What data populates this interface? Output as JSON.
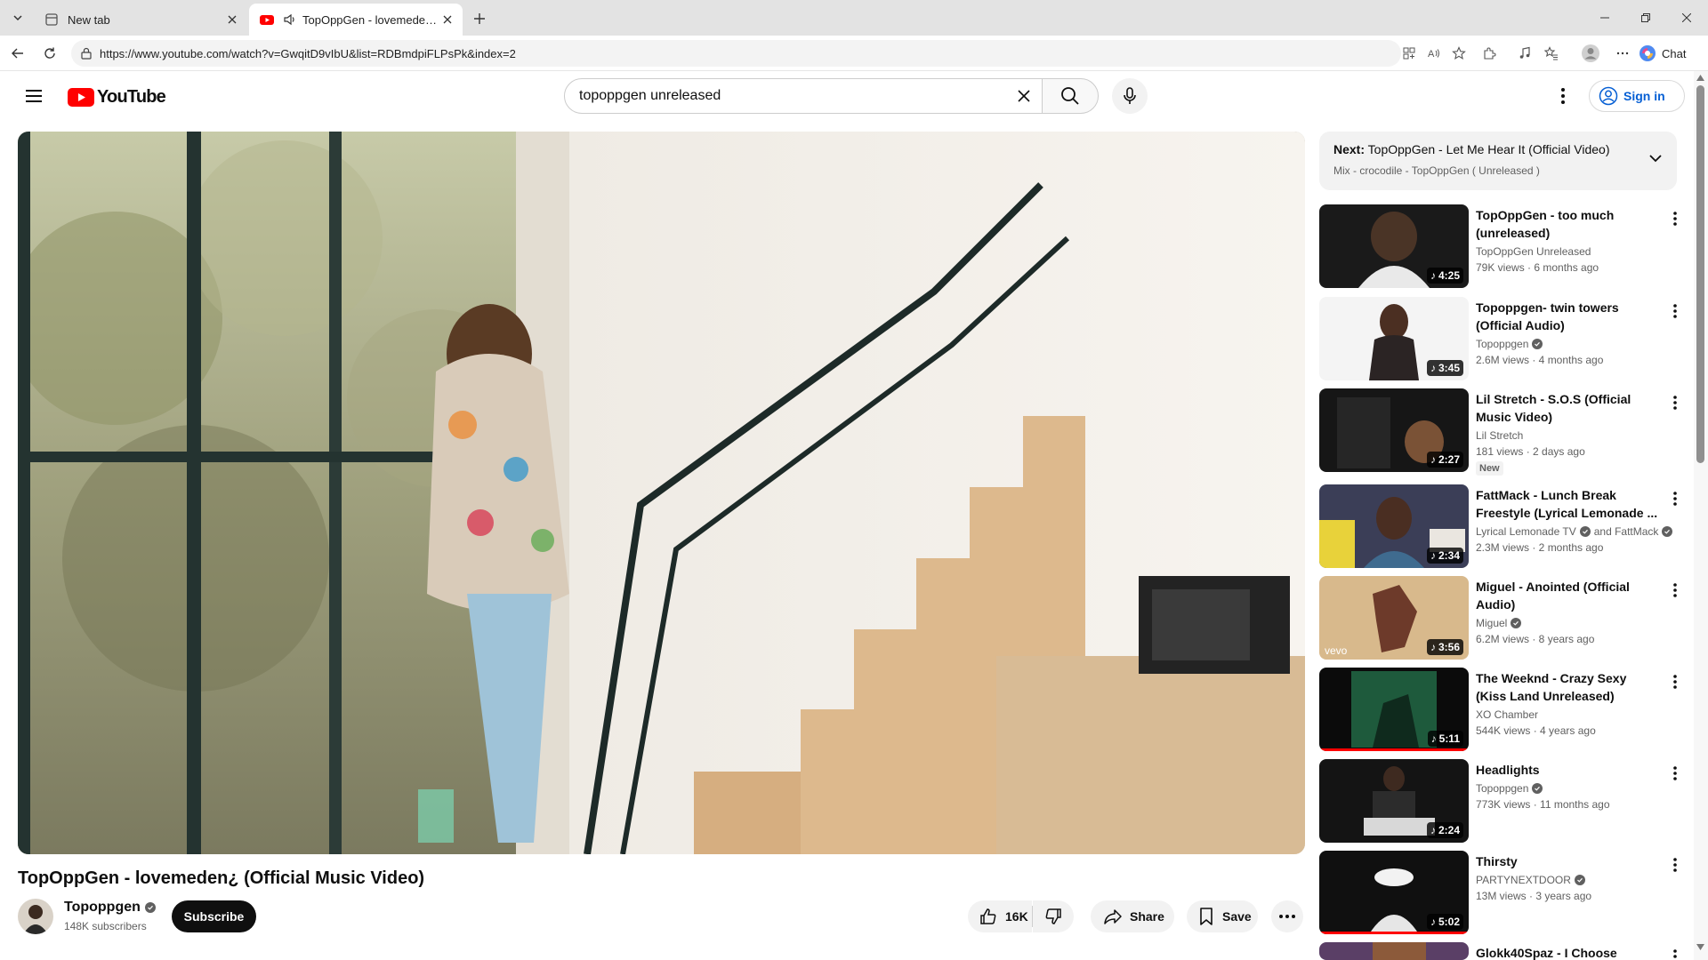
{
  "browser": {
    "tabs": [
      {
        "title": "New tab",
        "active": false
      },
      {
        "title": "TopOppGen - lovemeden¿ (Official Music Video)",
        "active": true
      }
    ],
    "url": "https://www.youtube.com/watch?v=GwqitD9vIbU&list=RDBmdpiFLPsPk&index=2",
    "chat_label": "Chat"
  },
  "youtube": {
    "logo_text": "YouTube",
    "search_query": "topoppgen unreleased",
    "sign_in_label": "Sign in"
  },
  "video": {
    "title": "TopOppGen - lovemeden¿ (Official Music Video)",
    "channel": "Topoppgen",
    "subscribers": "148K subscribers",
    "subscribe_label": "Subscribe",
    "likes": "16K",
    "share_label": "Share",
    "save_label": "Save"
  },
  "queue": {
    "next_prefix": "Next:",
    "next_title": "TopOppGen - Let Me Hear It (Official Video)",
    "mix_label": "Mix - crocodile - TopOppGen ( Unreleased )"
  },
  "recommendations": [
    {
      "title": "TopOppGen -  too much (unreleased)",
      "channel": "TopOppGen Unreleased",
      "verified": false,
      "meta": "79K views · 6 months ago",
      "duration": "4:25"
    },
    {
      "title": "Topoppgen- twin towers (Official Audio)",
      "channel": "Topoppgen",
      "verified": true,
      "meta": "2.6M views · 4 months ago",
      "duration": "3:45"
    },
    {
      "title": "Lil Stretch - S.O.S (Official Music Video)",
      "channel": "Lil Stretch",
      "verified": false,
      "meta": "181 views · 2 days ago",
      "badge": "New",
      "duration": "2:27"
    },
    {
      "title": "FattMack - Lunch Break Freestyle (Lyrical Lemonade ...",
      "channel": "Lyrical Lemonade TV",
      "channel2": "and FattMack",
      "verified": true,
      "meta": "2.3M views · 2 months ago",
      "duration": "2:34"
    },
    {
      "title": "Miguel - Anointed (Official Audio)",
      "channel": "Miguel",
      "verified": true,
      "meta": "6.2M views · 8 years ago",
      "duration": "3:56"
    },
    {
      "title": "The Weeknd - Crazy Sexy (Kiss Land Unreleased)",
      "channel": "XO Chamber",
      "verified": false,
      "meta": "544K views · 4 years ago",
      "duration": "5:11"
    },
    {
      "title": "Headlights",
      "channel": "Topoppgen",
      "verified": true,
      "meta": "773K views · 11 months ago",
      "duration": "2:24"
    },
    {
      "title": "Thirsty",
      "channel": "PARTYNEXTDOOR",
      "verified": true,
      "meta": "13M views · 3 years ago",
      "duration": "5:02"
    },
    {
      "title": "Glokk40Spaz - I Choose",
      "channel": "",
      "verified": false,
      "meta": "",
      "duration": ""
    }
  ],
  "icons": {
    "tab_menu": "chevron-down-icon",
    "mute": "speaker-icon",
    "back": "arrow-left-icon",
    "refresh": "refresh-icon",
    "search": "search-icon",
    "mic": "mic-icon",
    "like": "thumbs-up-icon",
    "dislike": "thumbs-down-icon",
    "share": "share-arrow-icon",
    "save": "bookmark-icon"
  },
  "colors": {
    "brand_red": "#ff0000",
    "link_blue": "#065fd4",
    "text_primary": "#0f0f0f",
    "text_secondary": "#606060",
    "chip_bg": "#f2f2f2"
  }
}
